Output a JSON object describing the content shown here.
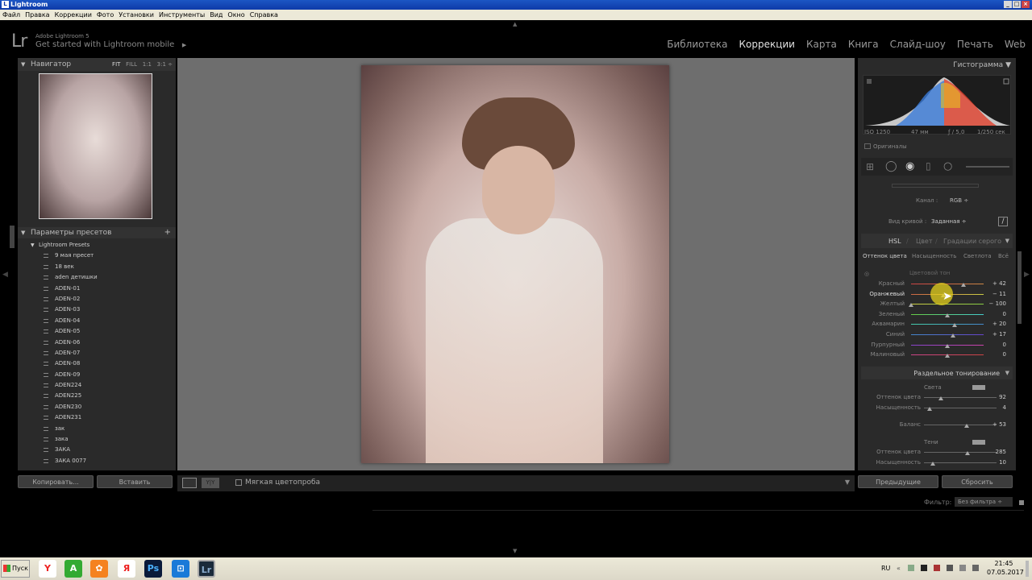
{
  "window": {
    "title": "Lightroom",
    "menu": [
      "Файл",
      "Правка",
      "Коррекции",
      "Фото",
      "Установки",
      "Инструменты",
      "Вид",
      "Окно",
      "Справка"
    ]
  },
  "brand": {
    "logo": "Lr",
    "product": "Adobe Lightroom 5",
    "subtitle": "Get started with Lightroom mobile",
    "play": "▶"
  },
  "modules": [
    "Библиотека",
    "Коррекции",
    "Карта",
    "Книга",
    "Слайд-шоу",
    "Печать",
    "Web"
  ],
  "navigator": {
    "title": "Навигатор",
    "zoom": [
      "FIT",
      "FILL",
      "1:1",
      "3:1"
    ]
  },
  "presets": {
    "title": "Параметры пресетов",
    "add": "+",
    "folder": "Lightroom Presets",
    "items": [
      "9 мая пресет",
      "18 век",
      "aden детишки",
      "ADEN-01",
      "ADEN-02",
      "ADEN-03",
      "ADEN-04",
      "ADEN-05",
      "ADEN-06",
      "ADEN-07",
      "ADEN-08",
      "ADEN-09",
      "ADEN224",
      "ADEN225",
      "ADEN230",
      "ADEN231",
      "зак",
      "зака",
      "ЗАКА",
      "ЗАКА 0077"
    ]
  },
  "left_buttons": {
    "copy": "Копировать...",
    "paste": "Вставить"
  },
  "toolbar": {
    "softproof": "Мягкая цветопроба",
    "yy": "Y|Y"
  },
  "histogram": {
    "title": "Гистограмма",
    "iso": "ISO 1250",
    "focal": "47 мм",
    "aperture": "ƒ / 5,0",
    "shutter": "1/250 сек",
    "originals": "Оригиналы"
  },
  "curve": {
    "channel_label": "Канал :",
    "channel_value": "RGB ÷",
    "view_label": "Вид кривой :",
    "view_value": "Заданная ÷"
  },
  "hsl": {
    "tabs": [
      "HSL",
      "Цвет",
      "Градации серого"
    ],
    "subtabs": [
      "Оттенок цвета",
      "Насыщенность",
      "Светлота",
      "Всё"
    ],
    "section": "Цветовой тон",
    "rows": [
      {
        "label": "Красный",
        "value": "+ 42",
        "pos": 0.72
      },
      {
        "label": "Оранжевый",
        "value": "− 11",
        "pos": 0.44
      },
      {
        "label": "Желтый",
        "value": "− 100",
        "pos": 0.0
      },
      {
        "label": "Зеленый",
        "value": "0",
        "pos": 0.5
      },
      {
        "label": "Аквамарин",
        "value": "+ 20",
        "pos": 0.6
      },
      {
        "label": "Синий",
        "value": "+ 17",
        "pos": 0.58
      },
      {
        "label": "Пурпурный",
        "value": "0",
        "pos": 0.5
      },
      {
        "label": "Малиновый",
        "value": "0",
        "pos": 0.5
      }
    ]
  },
  "split": {
    "title": "Раздельное тонирование",
    "highlights": "Света",
    "hue_label": "Оттенок цвета",
    "hue": "92",
    "sat_label": "Насыщенность",
    "sat": "4",
    "balance_label": "Баланс",
    "balance": "+ 53",
    "shadows": "Тени",
    "shue": "285",
    "ssat": "10"
  },
  "right_buttons": {
    "prev": "Предыдущие",
    "reset": "Сбросить"
  },
  "filter": {
    "label": "Фильтр:",
    "value": "Без фильтра"
  },
  "taskbar": {
    "start": "Пуск",
    "lang": "RU",
    "time": "21:45",
    "date": "07.05.2017"
  }
}
